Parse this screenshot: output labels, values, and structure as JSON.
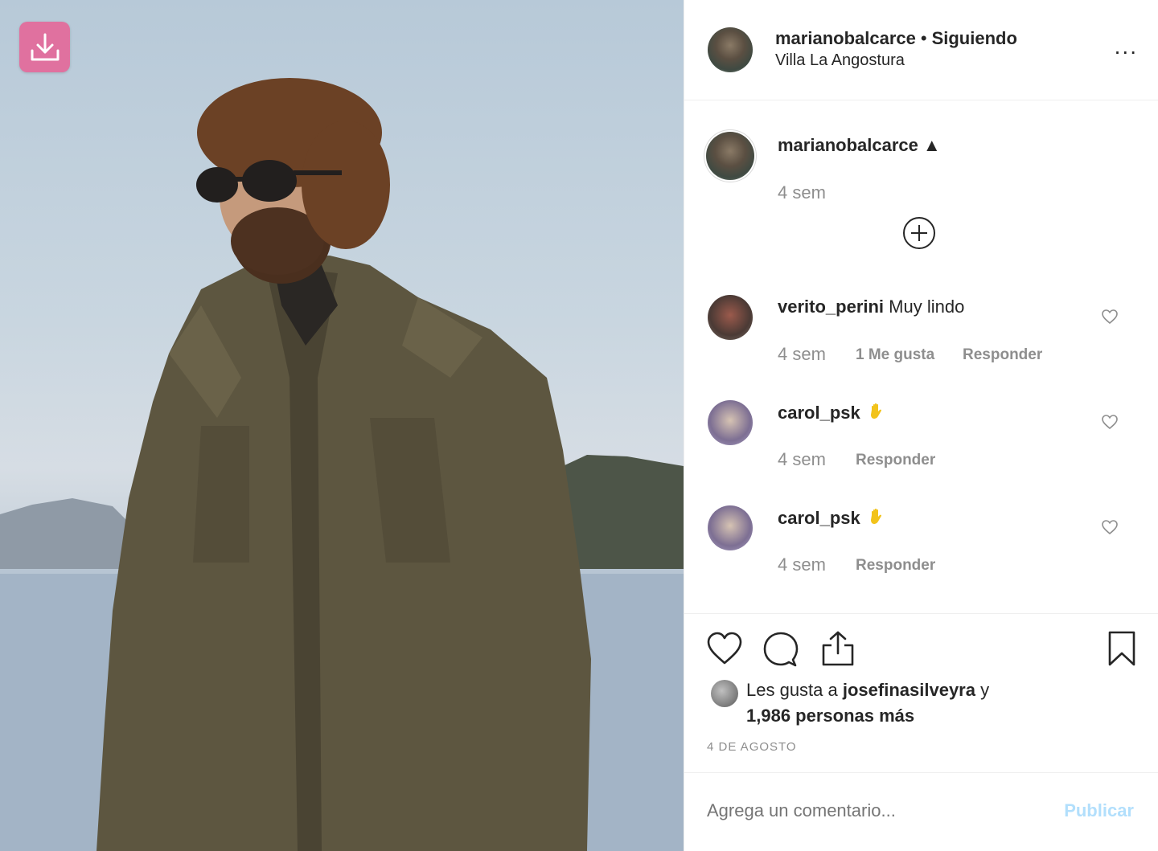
{
  "photo": {
    "download_icon": "download-icon"
  },
  "header": {
    "username": "marianobalcarce",
    "separator": "•",
    "follow_status": "Siguiendo",
    "location": "Villa La Angostura",
    "more_label": "..."
  },
  "caption": {
    "username": "marianobalcarce",
    "symbol": "▲",
    "time": "4 sem"
  },
  "comments": [
    {
      "username": "verito_perini",
      "text": "Muy lindo",
      "time": "4 sem",
      "likes": "1 Me gusta",
      "reply": "Responder"
    },
    {
      "username": "carol_psk",
      "text": "",
      "emoji_icon": "raised-hand-icon",
      "time": "4 sem",
      "reply": "Responder"
    },
    {
      "username": "carol_psk",
      "text": "",
      "emoji_icon": "raised-hand-icon",
      "time": "4 sem",
      "reply": "Responder"
    }
  ],
  "likes": {
    "prefix": "Les gusta a",
    "user": "josefinasilveyra",
    "conj": "y",
    "others": "1,986 personas más"
  },
  "date": "4 DE AGOSTO",
  "comment_box": {
    "placeholder": "Agrega un comentario...",
    "publish_label": "Publicar"
  },
  "colors": {
    "download_bg": "#e0719f",
    "publish": "#b2dffc",
    "muted": "#8e8e8e"
  }
}
